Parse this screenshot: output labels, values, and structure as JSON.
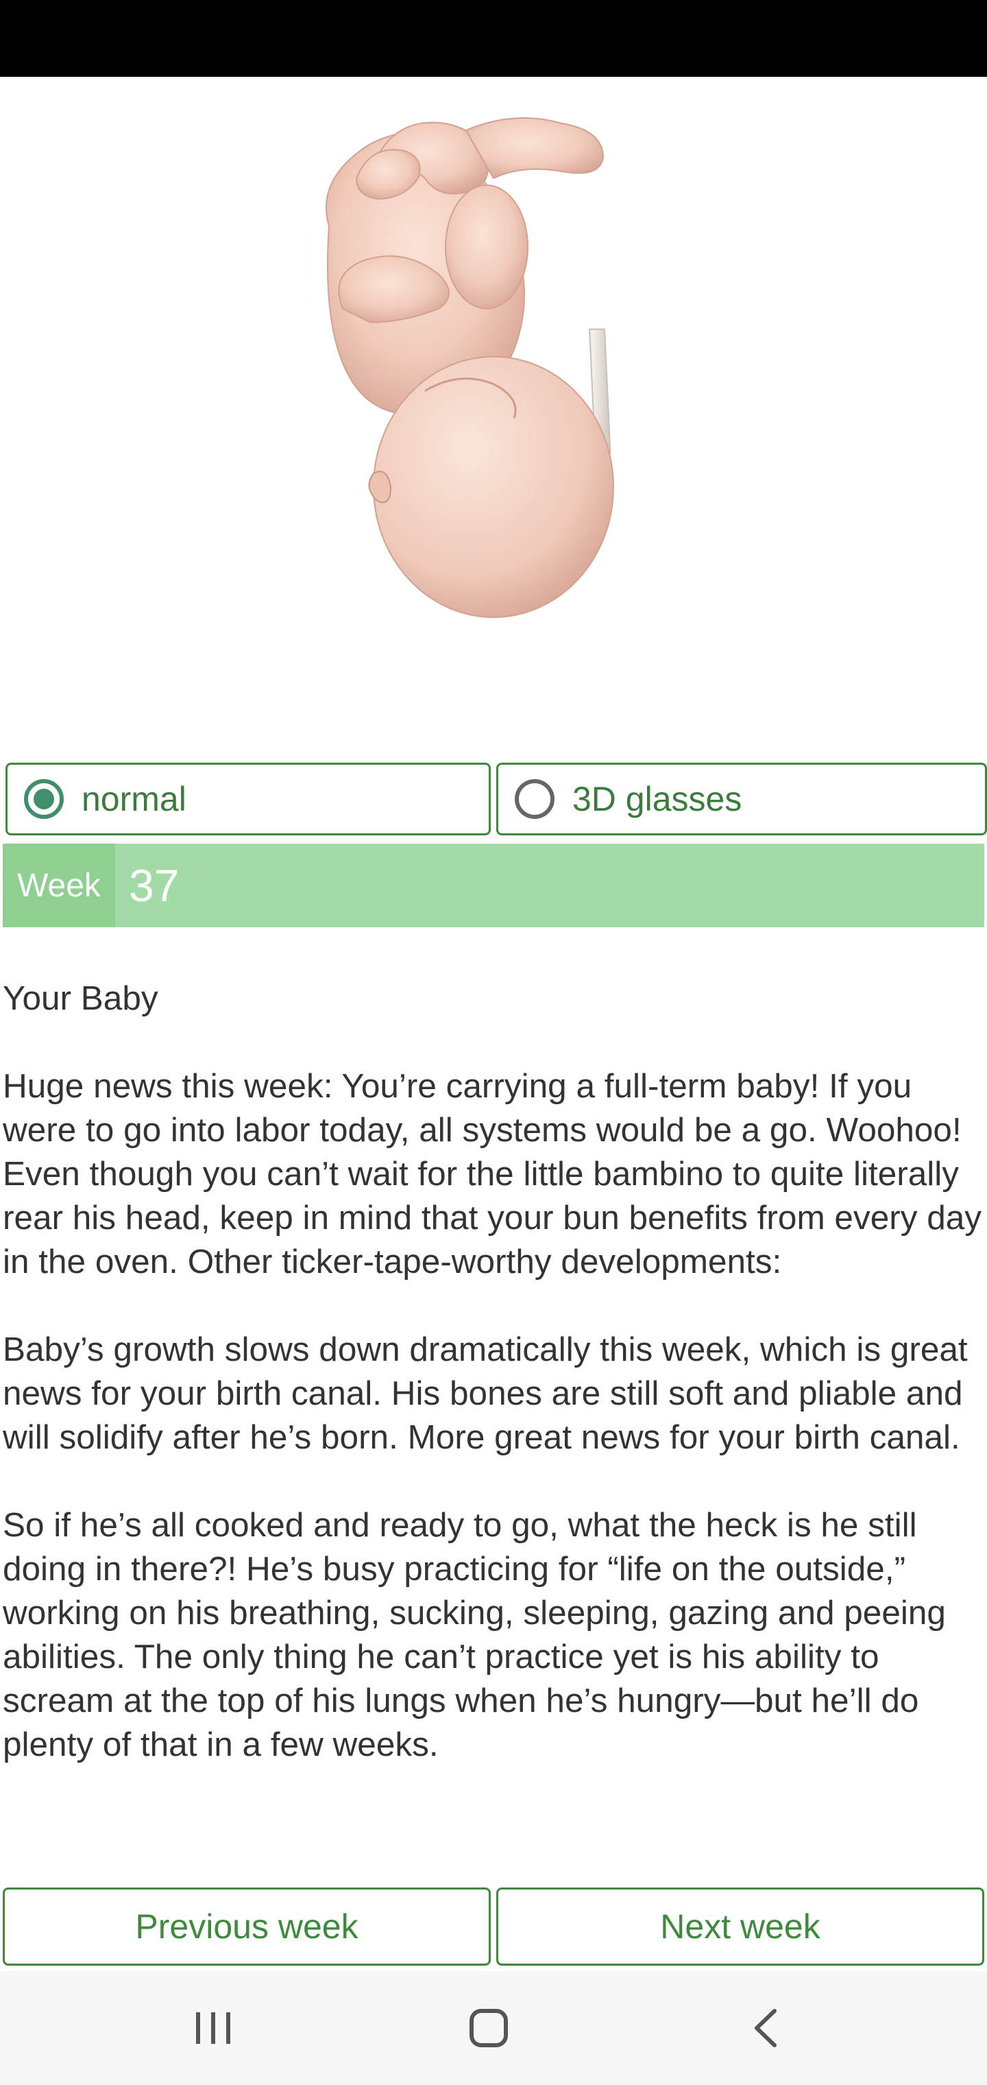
{
  "mode_selector": {
    "options": [
      {
        "label": "normal",
        "selected": true
      },
      {
        "label": "3D glasses",
        "selected": false
      }
    ]
  },
  "week": {
    "label": "Week",
    "value": "37"
  },
  "article": {
    "heading": "Your Baby",
    "paragraphs": [
      "Huge news this week: You’re carrying a full-term baby! If you were to go into labor today, all systems would be a go. Woohoo! Even though you can’t wait for the little bambino to quite literally rear his head, keep in mind that your bun benefits from every day in the oven. Other ticker-tape-worthy developments:",
      "Baby’s growth slows down dramatically this week, which is great news for your birth canal. His bones are still soft and pliable and will solidify after he’s born. More great news for your birth canal.",
      "So if he’s all cooked and ready to go, what the heck is he still doing in there?! He’s busy practicing for “life on the outside,” working on his breathing, sucking, sleeping, gazing and peeing abilities. The only thing he can’t practice yet is his ability to scream at the top of his lungs when he’s hungry—but he’ll do plenty of that in a few weeks."
    ]
  },
  "navigation": {
    "previous_label": "Previous week",
    "next_label": "Next week"
  },
  "system_nav": {
    "icons": [
      "recent-apps-icon",
      "home-icon",
      "back-icon"
    ]
  },
  "colors": {
    "accent_green": "#3d8a3d",
    "week_bar": "#a3dba7",
    "week_tag": "#8fd092",
    "status_bar": "#000000"
  }
}
